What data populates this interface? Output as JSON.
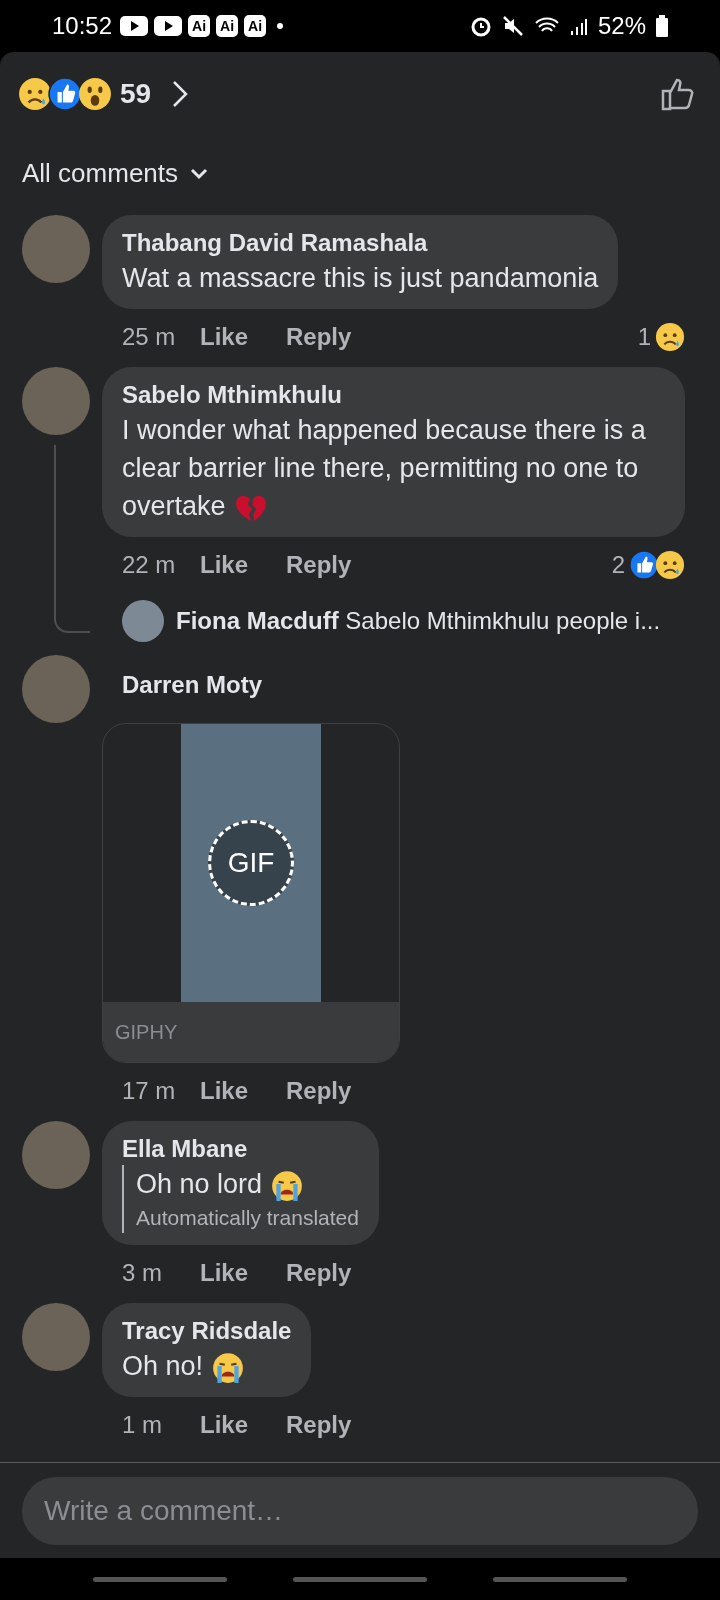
{
  "status_bar": {
    "time": "10:52",
    "badges": [
      {
        "kind": "play"
      },
      {
        "kind": "play"
      },
      {
        "kind": "text",
        "label": "Ai"
      },
      {
        "kind": "text",
        "label": "Ai"
      },
      {
        "kind": "text",
        "label": "Ai"
      }
    ],
    "battery": "52%"
  },
  "header": {
    "reactions": [
      {
        "kind": "sad"
      },
      {
        "kind": "like"
      },
      {
        "kind": "wow"
      }
    ],
    "count": "59"
  },
  "filter": {
    "label": "All comments"
  },
  "comments": [
    {
      "name": "Thabang David Ramashala",
      "text": "Wat a massacre this is just pandamonia",
      "time": "25 m",
      "actions": [
        "Like",
        "Reply"
      ],
      "reaction_count": "1",
      "reactions": [
        {
          "kind": "sad"
        }
      ]
    },
    {
      "name": "Sabelo Mthimkhulu",
      "text": "I wonder what happened because there is a clear barrier line there, permitting no one to overtake",
      "trailing_icon": {
        "kind": "broken_heart"
      },
      "time": "22 m",
      "actions": [
        "Like",
        "Reply"
      ],
      "reaction_count": "2",
      "reactions": [
        {
          "kind": "like"
        },
        {
          "kind": "sad"
        }
      ],
      "reply_preview": {
        "name": "Fiona Macduff",
        "text": "Sabelo Mthimkhulu people i..."
      }
    },
    {
      "name": "Darren Moty",
      "media": {
        "kind": "gif",
        "badge": "GIF",
        "source": "GIPHY"
      },
      "time": "17 m",
      "actions": [
        "Like",
        "Reply"
      ]
    },
    {
      "name": "Ella Mbane",
      "text": "Oh no lord",
      "trailing_icon": {
        "kind": "crying"
      },
      "note": "Automatically translated",
      "time": "3 m",
      "actions": [
        "Like",
        "Reply"
      ]
    },
    {
      "name": "Tracy Ridsdale",
      "text": "Oh no!",
      "trailing_icon": {
        "kind": "crying"
      },
      "time": "1 m",
      "actions": [
        "Like",
        "Reply"
      ]
    }
  ],
  "composer": {
    "placeholder": "Write a comment…"
  }
}
